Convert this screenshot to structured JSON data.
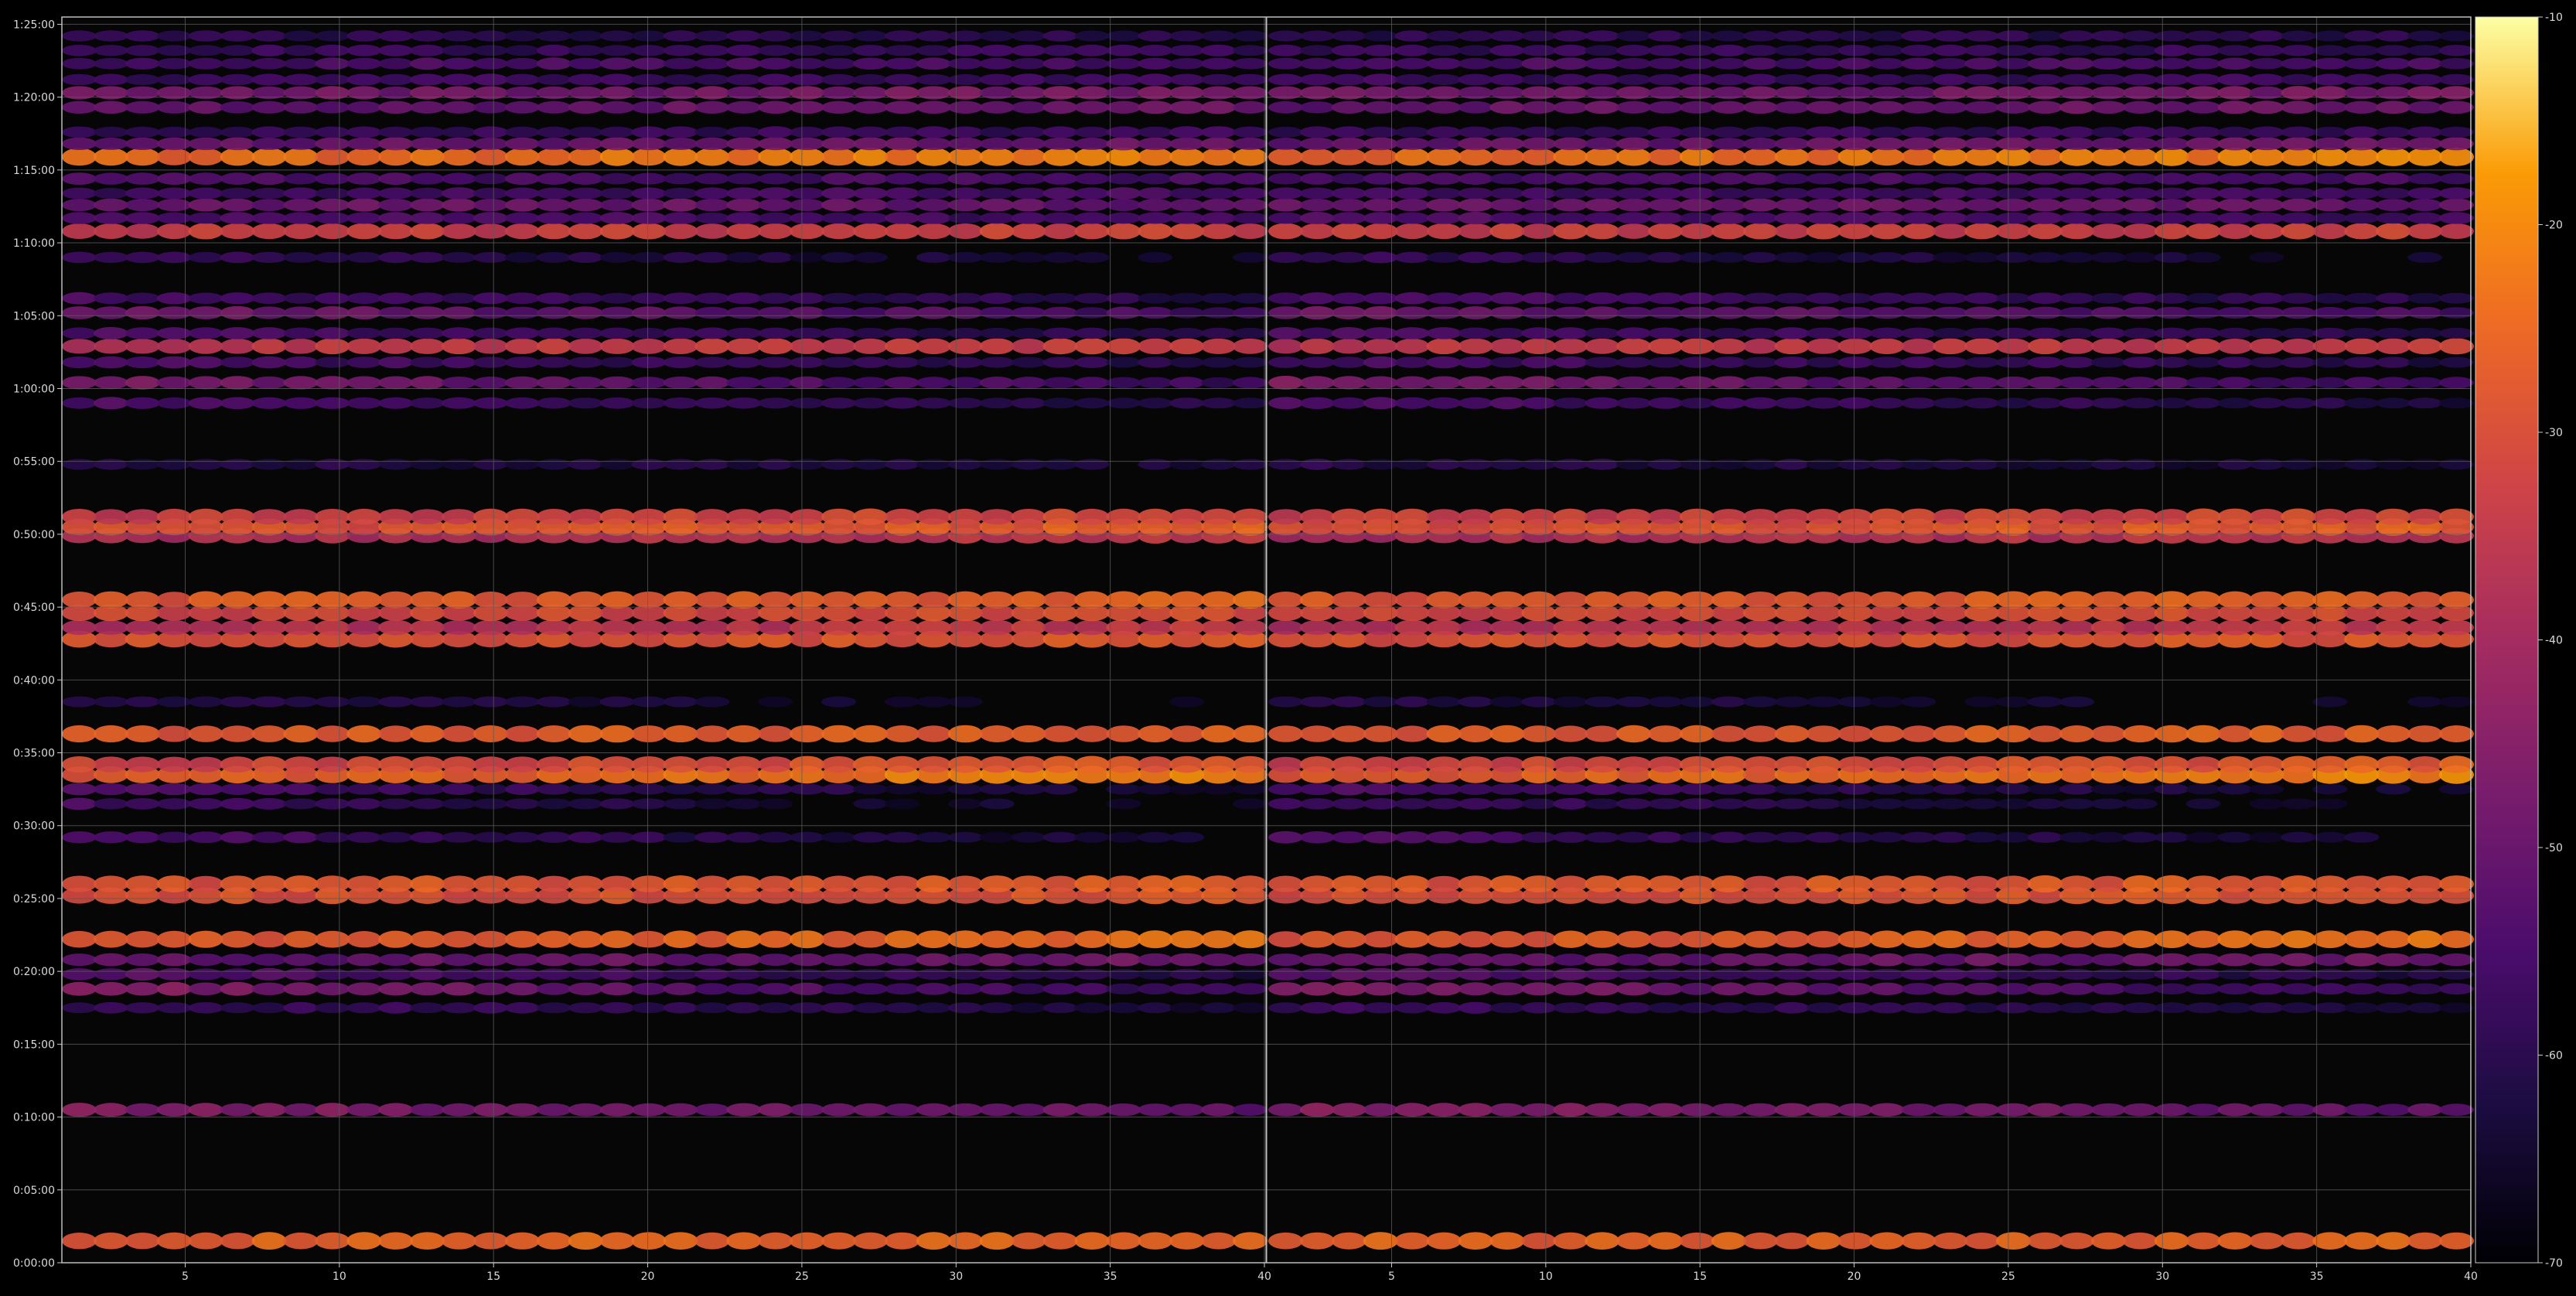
{
  "chart_data": {
    "type": "heatmap",
    "title": "",
    "xlabel": "",
    "ylabel": "",
    "grid": true,
    "legend": "colorbar-right",
    "colormap": "inferno",
    "background": "#000000",
    "grid_color": "#5a5a5a",
    "panels": [
      {
        "xlim": [
          1,
          40
        ],
        "x_ticks": [
          5,
          10,
          15,
          20,
          25,
          30,
          35,
          40
        ]
      },
      {
        "xlim": [
          40,
          79
        ],
        "x_ticks": [
          5,
          10,
          15,
          20,
          25,
          30,
          35,
          40
        ]
      }
    ],
    "x_tick_labels": [
      "5",
      "10",
      "15",
      "20",
      "25",
      "30",
      "35",
      "40"
    ],
    "y_tick_labels": [
      "0:00:00",
      "0:05:00",
      "0:10:00",
      "0:15:00",
      "0:20:00",
      "0:25:00",
      "0:30:00",
      "0:35:00",
      "0:40:00",
      "0:45:00",
      "0:50:00",
      "0:55:00",
      "1:00:00",
      "1:05:00",
      "1:10:00",
      "1:15:00",
      "1:20:00",
      "1:25:00"
    ],
    "y_ticks_minutes": [
      0,
      5,
      10,
      15,
      20,
      25,
      30,
      35,
      40,
      45,
      50,
      55,
      60,
      65,
      70,
      75,
      80,
      85
    ],
    "ylim_minutes": [
      0,
      85.5
    ],
    "colorbar": {
      "range": [
        -70,
        -10
      ],
      "ticks": [
        -70,
        -60,
        -50,
        -40,
        -30,
        -20,
        -10
      ],
      "tick_labels": [
        "-70",
        "-60",
        "-50",
        "-40",
        "-30",
        "-20",
        "-10"
      ]
    },
    "bands": [
      {
        "t": 1.5,
        "level": -26,
        "trend": 0.01
      },
      {
        "t": 10.5,
        "level": -48,
        "trend": -0.15
      },
      {
        "t": 17.5,
        "level": -60,
        "trend": -0.15
      },
      {
        "t": 18.8,
        "level": -52,
        "trend": -0.4
      },
      {
        "t": 19.8,
        "level": -57,
        "trend": -0.25
      },
      {
        "t": 20.8,
        "level": -50,
        "trend": 0.08
      },
      {
        "t": 22.2,
        "level": -26,
        "trend": 0.18
      },
      {
        "t": 25.2,
        "level": -29,
        "trend": 0.02
      },
      {
        "t": 26.0,
        "level": -28,
        "trend": 0.05
      },
      {
        "t": 29.2,
        "level": -60,
        "trend": -0.3
      },
      {
        "t": 31.5,
        "level": -62,
        "trend": -0.35
      },
      {
        "t": 32.5,
        "level": -60,
        "trend": -0.3
      },
      {
        "t": 33.5,
        "level": -24,
        "trend": 0.22
      },
      {
        "t": 34.2,
        "level": -30,
        "trend": 0.15
      },
      {
        "t": 36.3,
        "level": -27,
        "trend": 0.05
      },
      {
        "t": 38.5,
        "level": -64,
        "trend": -0.2
      },
      {
        "t": 42.8,
        "level": -29,
        "trend": 0.05
      },
      {
        "t": 43.6,
        "level": -36,
        "trend": 0.12
      },
      {
        "t": 44.6,
        "level": -31,
        "trend": 0.05
      },
      {
        "t": 45.5,
        "level": -27,
        "trend": 0.05
      },
      {
        "t": 49.9,
        "level": -37,
        "trend": 0.1
      },
      {
        "t": 50.5,
        "level": -28,
        "trend": 0.1
      },
      {
        "t": 51.2,
        "level": -32,
        "trend": 0.08
      },
      {
        "t": 54.8,
        "level": -62,
        "trend": -0.1
      },
      {
        "t": 59.0,
        "level": -58,
        "trend": -0.2
      },
      {
        "t": 60.4,
        "level": -52,
        "trend": -0.3
      },
      {
        "t": 61.8,
        "level": -58,
        "trend": -0.15
      },
      {
        "t": 62.9,
        "level": -34,
        "trend": 0.08
      },
      {
        "t": 63.8,
        "level": -58,
        "trend": -0.2
      },
      {
        "t": 65.2,
        "level": -52,
        "trend": -0.2
      },
      {
        "t": 66.2,
        "level": -58,
        "trend": -0.15
      },
      {
        "t": 69.0,
        "level": -62,
        "trend": -0.2
      },
      {
        "t": 70.8,
        "level": -33,
        "trend": 0.05
      },
      {
        "t": 71.7,
        "level": -55,
        "trend": -0.1
      },
      {
        "t": 72.6,
        "level": -50,
        "trend": 0.0
      },
      {
        "t": 73.4,
        "level": -56,
        "trend": 0.05
      },
      {
        "t": 74.4,
        "level": -55,
        "trend": 0.0
      },
      {
        "t": 75.9,
        "level": -23,
        "trend": 0.15
      },
      {
        "t": 76.8,
        "level": -50,
        "trend": 0.05
      },
      {
        "t": 77.6,
        "level": -58,
        "trend": 0.05
      },
      {
        "t": 79.3,
        "level": -50,
        "trend": 0.05
      },
      {
        "t": 80.3,
        "level": -48,
        "trend": 0.05
      },
      {
        "t": 81.2,
        "level": -57,
        "trend": 0.0
      },
      {
        "t": 82.3,
        "level": -55,
        "trend": 0.0
      },
      {
        "t": 83.2,
        "level": -58,
        "trend": 0.0
      },
      {
        "t": 84.2,
        "level": -60,
        "trend": 0.0
      }
    ]
  }
}
